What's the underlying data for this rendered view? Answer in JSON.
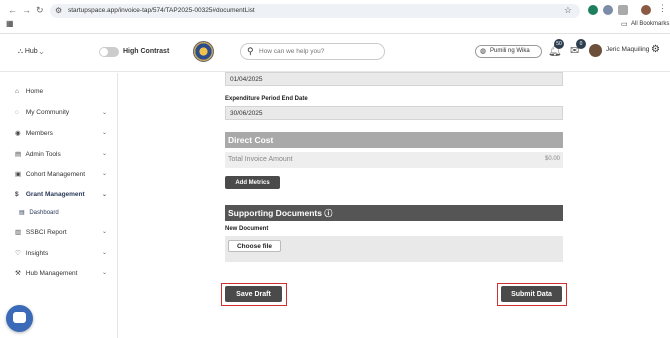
{
  "browser": {
    "url": "startupspace.app/invoice-tap/574/TAP2025-00325#documentList",
    "bookmarks_label": "All Bookmarks"
  },
  "header": {
    "hub_label": "Hub",
    "high_contrast_label": "High Contrast",
    "search_placeholder": "How can we help you?",
    "language": "Pumili ng Wika",
    "notifications_count": "50",
    "messages_count": "0",
    "user_name": "Jeric Maquiling"
  },
  "sidebar": {
    "items": [
      {
        "label": "Home",
        "icon": "home-icon"
      },
      {
        "label": "My Community",
        "icon": "community-icon"
      },
      {
        "label": "Members",
        "icon": "user-icon"
      },
      {
        "label": "Admin Tools",
        "icon": "tools-icon"
      },
      {
        "label": "Cohort Management",
        "icon": "cohort-icon"
      },
      {
        "label": "Grant Management",
        "icon": "dollar-icon"
      },
      {
        "label": "SSBCI Report",
        "icon": "report-icon"
      },
      {
        "label": "Insights",
        "icon": "bulb-icon"
      },
      {
        "label": "Hub Management",
        "icon": "wrench-icon"
      }
    ],
    "sub_item": "Dashboard"
  },
  "form": {
    "start_date_value": "01/04/2025",
    "end_date_label": "Expenditure Period End Date",
    "end_date_value": "30/06/2025",
    "direct_cost_title": "Direct Cost",
    "total_invoice_label": "Total Invoice Amount",
    "total_invoice_value": "$0.00",
    "add_metrics_label": "Add Metrics",
    "supporting_docs_title": "Supporting Documents",
    "new_document_label": "New Document",
    "choose_file_label": "Choose file",
    "save_draft_label": "Save Draft",
    "submit_data_label": "Submit Data"
  },
  "colors": {
    "section_direct_cost": "#a9a9a9",
    "section_supporting": "#555555",
    "highlight_frame": "#d32f2f",
    "button_dark": "#4a4a4a"
  }
}
